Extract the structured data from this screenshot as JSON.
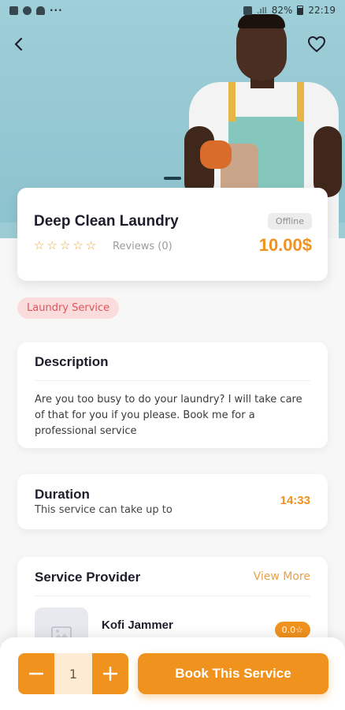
{
  "status_bar": {
    "battery": "82%",
    "time": "22:19"
  },
  "service": {
    "title": "Deep Clean Laundry",
    "status": "Offline",
    "rating_stars": 0,
    "reviews_label": "Reviews (0)",
    "price": "10.00$",
    "category": "Laundry Service"
  },
  "description": {
    "heading": "Description",
    "text": "Are you too busy to do your laundry? I will take care of that for you if you please. Book me for a professional service"
  },
  "duration": {
    "heading": "Duration",
    "subtitle": "This service can take up to",
    "value": "14:33"
  },
  "provider": {
    "heading": "Service Provider",
    "view_more": "View More",
    "name": "Kofi Jammer",
    "rating": "0.0☆"
  },
  "booking": {
    "quantity": "1",
    "minus": "−",
    "plus": "+",
    "book_label": "Book This Service"
  },
  "colors": {
    "accent": "#f0921e",
    "chip_bg": "#fbdcdc",
    "chip_text": "#e1535a"
  },
  "icons": [
    "back-arrow-icon",
    "heart-icon",
    "star-outline-icon",
    "image-placeholder-icon"
  ]
}
